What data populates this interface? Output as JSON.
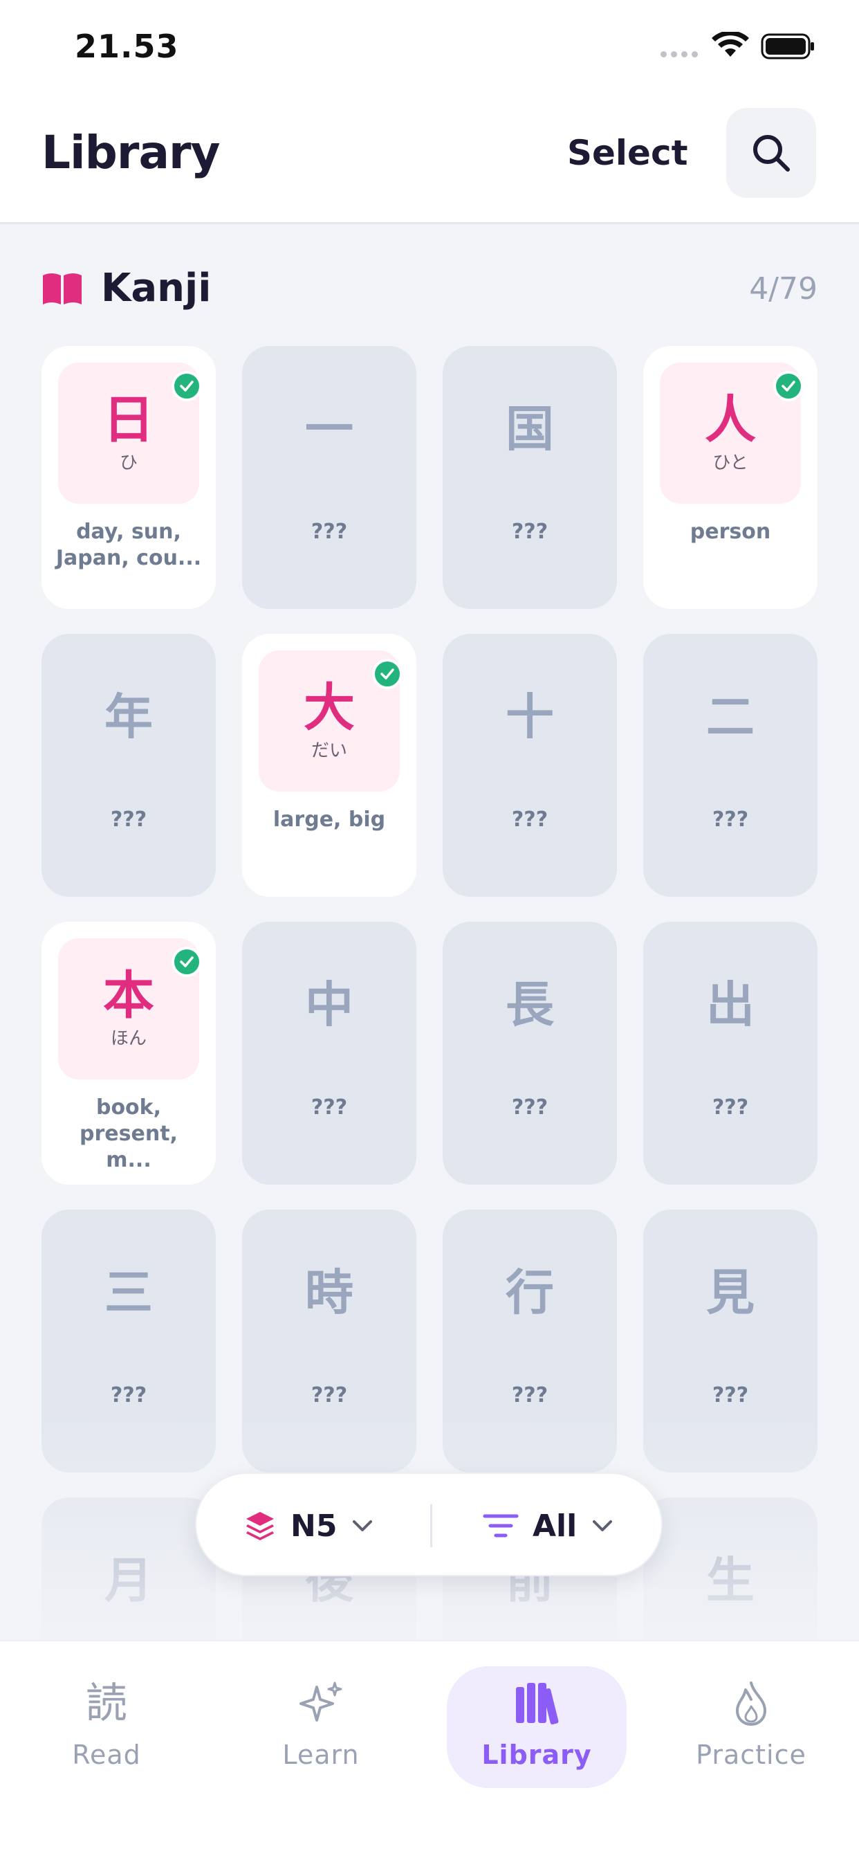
{
  "status_bar": {
    "time": "21.53"
  },
  "header": {
    "title": "Library",
    "select_label": "Select"
  },
  "section": {
    "title": "Kanji",
    "count": "4/79"
  },
  "cards": [
    {
      "kanji": "日",
      "reading": "ひ",
      "meaning": "day, sun, Japan, cou...",
      "learned": true
    },
    {
      "kanji": "一",
      "reading": "",
      "meaning": "???",
      "learned": false
    },
    {
      "kanji": "国",
      "reading": "",
      "meaning": "???",
      "learned": false
    },
    {
      "kanji": "人",
      "reading": "ひと",
      "meaning": "person",
      "learned": true
    },
    {
      "kanji": "年",
      "reading": "",
      "meaning": "???",
      "learned": false
    },
    {
      "kanji": "大",
      "reading": "だい",
      "meaning": "large, big",
      "learned": true
    },
    {
      "kanji": "十",
      "reading": "",
      "meaning": "???",
      "learned": false
    },
    {
      "kanji": "二",
      "reading": "",
      "meaning": "???",
      "learned": false
    },
    {
      "kanji": "本",
      "reading": "ほん",
      "meaning": "book, present, m...",
      "learned": true
    },
    {
      "kanji": "中",
      "reading": "",
      "meaning": "???",
      "learned": false
    },
    {
      "kanji": "長",
      "reading": "",
      "meaning": "???",
      "learned": false
    },
    {
      "kanji": "出",
      "reading": "",
      "meaning": "???",
      "learned": false
    },
    {
      "kanji": "三",
      "reading": "",
      "meaning": "???",
      "learned": false
    },
    {
      "kanji": "時",
      "reading": "",
      "meaning": "???",
      "learned": false
    },
    {
      "kanji": "行",
      "reading": "",
      "meaning": "???",
      "learned": false
    },
    {
      "kanji": "見",
      "reading": "",
      "meaning": "???",
      "learned": false
    },
    {
      "kanji": "月",
      "reading": "",
      "meaning": "",
      "learned": false
    },
    {
      "kanji": "後",
      "reading": "",
      "meaning": "",
      "learned": false
    },
    {
      "kanji": "前",
      "reading": "",
      "meaning": "",
      "learned": false
    },
    {
      "kanji": "生",
      "reading": "",
      "meaning": "",
      "learned": false
    }
  ],
  "filter_bar": {
    "level": "N5",
    "filter": "All"
  },
  "nav": {
    "read": {
      "icon": "読",
      "label": "Read"
    },
    "learn": {
      "label": "Learn"
    },
    "library": {
      "label": "Library"
    },
    "practice": {
      "label": "Practice"
    }
  },
  "colors": {
    "accent": "#e12d7f",
    "active_nav": "#8b5cf6",
    "check": "#23b47e",
    "locked_card": "#e2e7ef"
  }
}
